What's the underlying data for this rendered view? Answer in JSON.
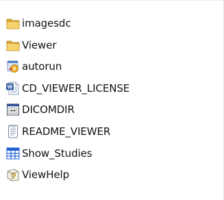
{
  "files": [
    {
      "name": "imagesdc",
      "icon": "folder-icon"
    },
    {
      "name": "Viewer",
      "icon": "folder-icon"
    },
    {
      "name": "autorun",
      "icon": "autorun-setup-icon"
    },
    {
      "name": "CD_VIEWER_LICENSE",
      "icon": "word-document-icon"
    },
    {
      "name": "DICOMDIR",
      "icon": "dicomdir-window-icon"
    },
    {
      "name": "README_VIEWER",
      "icon": "text-document-icon"
    },
    {
      "name": "Show_Studies",
      "icon": "grid-table-icon"
    },
    {
      "name": "ViewHelp",
      "icon": "help-file-icon"
    }
  ],
  "colors": {
    "folder": "#f2c94c",
    "word_blue": "#2b57a8",
    "grid_blue": "#1f5fd1"
  }
}
